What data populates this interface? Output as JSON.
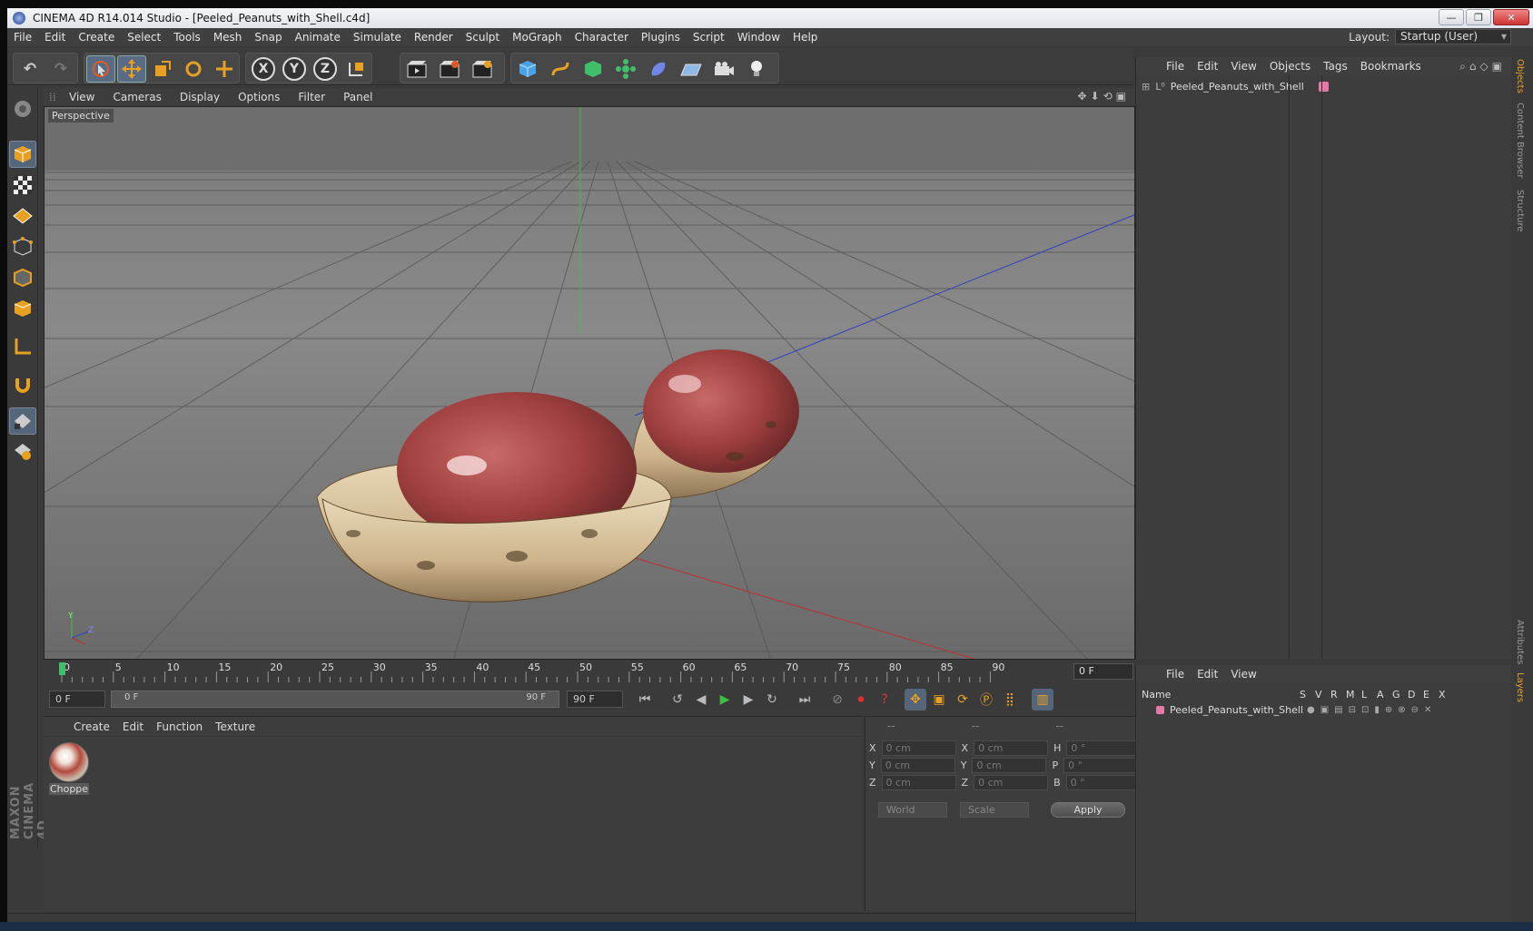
{
  "window": {
    "title": "CINEMA 4D R14.014 Studio - [Peeled_Peanuts_with_Shell.c4d]",
    "minimize": "—",
    "restore": "❐",
    "close": "✕"
  },
  "menubar": {
    "items": [
      "File",
      "Edit",
      "Create",
      "Select",
      "Tools",
      "Mesh",
      "Snap",
      "Animate",
      "Simulate",
      "Render",
      "Sculpt",
      "MoGraph",
      "Character",
      "Plugins",
      "Script",
      "Window",
      "Help"
    ],
    "layout_label": "Layout:",
    "layout_value": "Startup (User)"
  },
  "toolbar": {
    "undo": "↶",
    "redo": "↷",
    "axis_x": "X",
    "axis_y": "Y",
    "axis_z": "Z"
  },
  "viewport": {
    "menu": [
      "View",
      "Cameras",
      "Display",
      "Options",
      "Filter",
      "Panel"
    ],
    "label": "Perspective",
    "nav_icons": "✥⬇⟲▣",
    "axis_x": "Z",
    "axis_y": "Y"
  },
  "timeline": {
    "ticks": [
      "0",
      "5",
      "10",
      "15",
      "20",
      "25",
      "30",
      "35",
      "40",
      "45",
      "50",
      "55",
      "60",
      "65",
      "70",
      "75",
      "80",
      "85",
      "90"
    ],
    "current_frame": "0 F",
    "start_field": "0 F",
    "range_start": "0 F",
    "range_end": "90 F",
    "end_field": "90 F"
  },
  "material_manager": {
    "menu": [
      "Create",
      "Edit",
      "Function",
      "Texture"
    ],
    "materials": [
      "Choppe"
    ]
  },
  "coordinates": {
    "headers": [
      "--",
      "--",
      "--"
    ],
    "rows": [
      {
        "a": "X",
        "av": "0 cm",
        "b": "X",
        "bv": "0 cm",
        "c": "H",
        "cv": "0 °"
      },
      {
        "a": "Y",
        "av": "0 cm",
        "b": "Y",
        "bv": "0 cm",
        "c": "P",
        "cv": "0 °"
      },
      {
        "a": "Z",
        "av": "0 cm",
        "b": "Z",
        "bv": "0 cm",
        "c": "B",
        "cv": "0 °"
      }
    ],
    "mode": "World",
    "transform": "Scale",
    "apply": "Apply"
  },
  "object_manager": {
    "menu": [
      "File",
      "Edit",
      "View",
      "Objects",
      "Tags",
      "Bookmarks"
    ],
    "object_name": "Peeled_Peanuts_with_Shell"
  },
  "layer_manager": {
    "menu": [
      "File",
      "Edit",
      "View"
    ],
    "columns": [
      "Name",
      "S",
      "V",
      "R",
      "M",
      "L",
      "A",
      "G",
      "D",
      "E",
      "X"
    ],
    "layer_name": "Peeled_Peanuts_with_Shell"
  },
  "side_tabs": [
    "Objects",
    "Content Browser",
    "Structure",
    "Attributes",
    "Layers"
  ],
  "branding": "MAXON CINEMA 4D",
  "colors": {
    "accent": "#e8a020",
    "selection": "#5a6b84",
    "tag": "#e67aa6"
  }
}
